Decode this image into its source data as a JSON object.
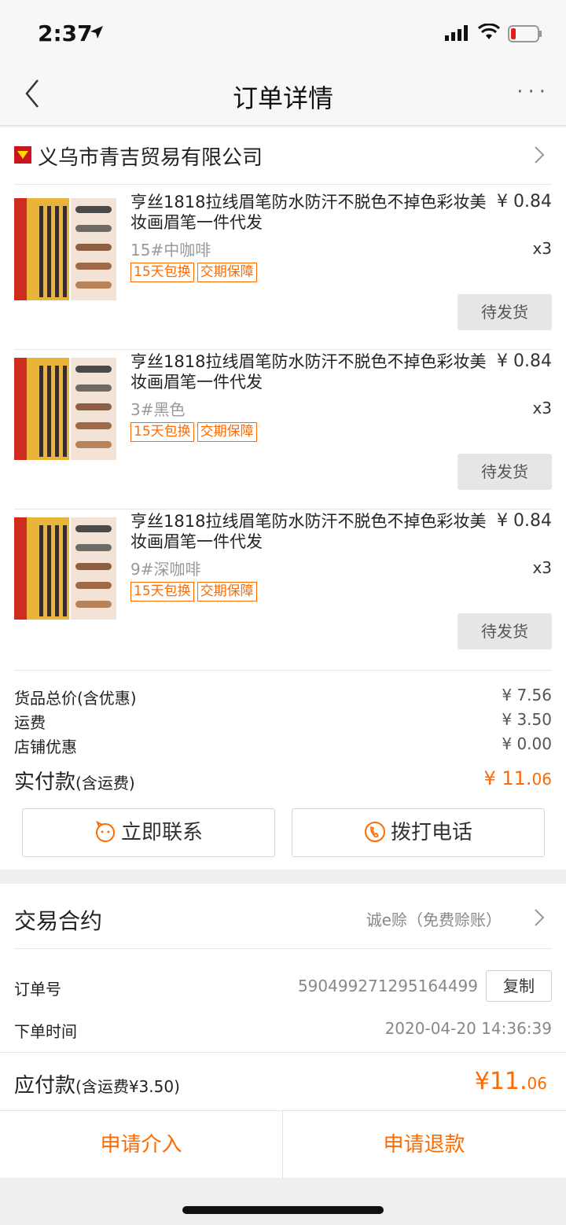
{
  "status_bar": {
    "time": "2:37"
  },
  "nav": {
    "title": "订单详情",
    "more": "···"
  },
  "shop": {
    "name": "义乌市青吉贸易有限公司"
  },
  "items": [
    {
      "title": "亨丝1818拉线眉笔防水防汗不脱色不掉色彩妆美妆画眉笔一件代发",
      "price": "¥ 0.84",
      "variant": "15#中咖啡",
      "qty": "x3",
      "tags": [
        "15天包换",
        "交期保障"
      ],
      "status": "待发货"
    },
    {
      "title": "亨丝1818拉线眉笔防水防汗不脱色不掉色彩妆美妆画眉笔一件代发",
      "price": "¥ 0.84",
      "variant": "3#黑色",
      "qty": "x3",
      "tags": [
        "15天包换",
        "交期保障"
      ],
      "status": "待发货"
    },
    {
      "title": "亨丝1818拉线眉笔防水防汗不脱色不掉色彩妆美妆画眉笔一件代发",
      "price": "¥ 0.84",
      "variant": "9#深咖啡",
      "qty": "x3",
      "tags": [
        "15天包换",
        "交期保障"
      ],
      "status": "待发货"
    }
  ],
  "summary": {
    "goods_label": "货品总价(含优惠)",
    "goods_value": "¥ 7.56",
    "shipping_label": "运费",
    "shipping_value": "¥ 3.50",
    "discount_label": "店铺优惠",
    "discount_value": "¥ 0.00",
    "paid_label": "实付款",
    "paid_suffix": "(含运费)",
    "paid_main": "¥ 11.",
    "paid_cents": "06"
  },
  "actions": {
    "contact": "立即联系",
    "call": "拨打电话"
  },
  "contract": {
    "label": "交易合约",
    "value": "诚e赊（免费赊账）"
  },
  "order": {
    "number_label": "订单号",
    "number": "590499271295164499",
    "copy": "复制",
    "time_label": "下单时间",
    "time": "2020-04-20 14:36:39"
  },
  "payable": {
    "label": "应付款",
    "suffix": "(含运费¥3.50)",
    "main": "¥11.",
    "cents": "06"
  },
  "bottom": {
    "intervene": "申请介入",
    "refund": "申请退款"
  },
  "colors": {
    "accent": "#ff6a00",
    "shop_icon": "#c8161d"
  }
}
